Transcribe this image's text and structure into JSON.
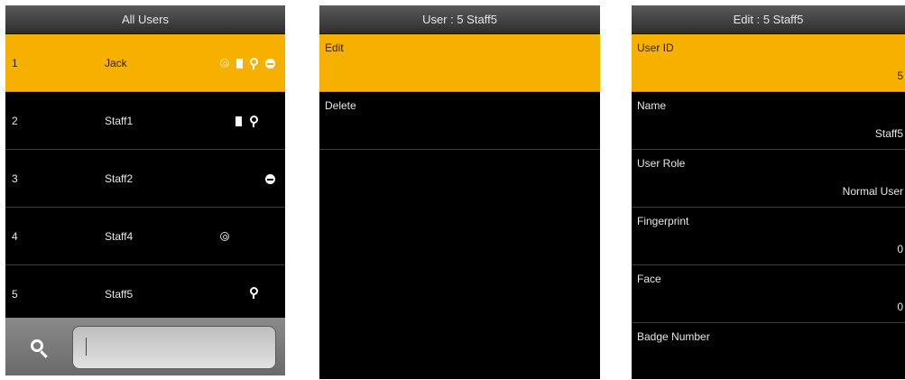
{
  "screen1": {
    "title": "All Users",
    "users": [
      {
        "num": "1",
        "name": "Jack",
        "icons": [
          "fingerprint-icon",
          "card-icon",
          "key-icon",
          "face-icon"
        ]
      },
      {
        "num": "2",
        "name": "Staff1",
        "icons": [
          "card-icon",
          "key-icon"
        ]
      },
      {
        "num": "3",
        "name": "Staff2",
        "icons": [
          "face-icon"
        ]
      },
      {
        "num": "4",
        "name": "Staff4",
        "icons": [
          "fingerprint-icon"
        ]
      },
      {
        "num": "5",
        "name": "Staff5",
        "icons": [
          "key-icon"
        ]
      }
    ],
    "search": {
      "icon": "search-icon",
      "value": ""
    }
  },
  "screen2": {
    "title": "User : 5 Staff5",
    "items": [
      "Edit",
      "Delete"
    ]
  },
  "screen3": {
    "title": "Edit : 5 Staff5",
    "fields": [
      {
        "label": "User ID",
        "value": "5"
      },
      {
        "label": "Name",
        "value": "Staff5"
      },
      {
        "label": "User Role",
        "value": "Normal User"
      },
      {
        "label": "Fingerprint",
        "value": "0"
      },
      {
        "label": "Face",
        "value": "0"
      },
      {
        "label": "Badge Number",
        "value": ""
      }
    ]
  },
  "colors": {
    "highlight": "#f5b000",
    "background": "#000000"
  }
}
